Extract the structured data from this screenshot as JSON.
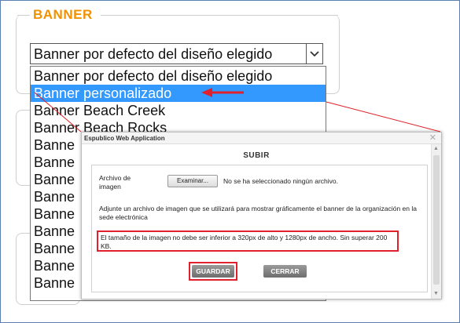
{
  "section": {
    "legend": "BANNER"
  },
  "select": {
    "value": "Banner por defecto del diseño elegido"
  },
  "dropdown": {
    "options": [
      "Banner por defecto del diseño elegido",
      "Banner personalizado",
      "Banner Beach Creek",
      "Banner Beach Rocks",
      "Banne",
      "Banne",
      "Banne",
      "Banne",
      "Banne",
      "Banne",
      "Banne",
      "Banne",
      "Banne"
    ]
  },
  "modal": {
    "app_title": "Espublico Web Application",
    "heading": "SUBIR",
    "file_label": "Archivo de imagen",
    "browse_label": "Examinar...",
    "file_status": "No se ha seleccionado ningún archivo.",
    "description": "Adjunte un archivo de imagen que se utilizará para mostrar gráficamente el banner de la organización en la sede electrónica",
    "warning": "El tamaño de la imagen no debe ser inferior a 320px de alto y 1280px de ancho. Sin superar 200 KB.",
    "save_label": "GUARDAR",
    "close_label": "CERRAR"
  },
  "colors": {
    "legend": "#f29100",
    "highlight": "#3399ff",
    "annotation": "#e0202a"
  }
}
